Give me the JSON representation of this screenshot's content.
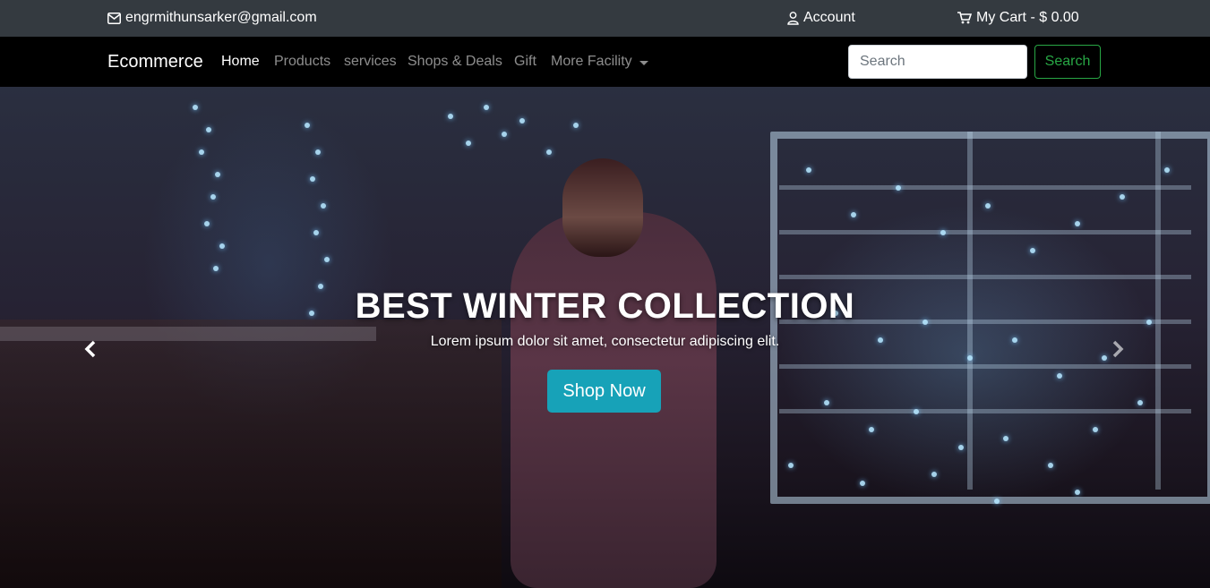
{
  "topbar": {
    "email": "engrmithunsarker@gmail.com",
    "account_label": "Account",
    "cart_label": "My Cart - $ 0.00",
    "icons": {
      "email": "envelope-icon",
      "account": "user-icon",
      "cart": "shopping-cart-icon"
    }
  },
  "navbar": {
    "brand": "Ecommerce",
    "links": [
      {
        "label": "Home",
        "active": true
      },
      {
        "label": "Products"
      },
      {
        "label": "services"
      },
      {
        "label": "Shops & Deals"
      },
      {
        "label": "Gift"
      },
      {
        "label": "More Facility"
      }
    ],
    "search_placeholder": "Search",
    "search_button": "Search"
  },
  "hero": {
    "title": "BEST WINTER COLLECTION",
    "subtitle": "Lorem ipsum dolor sit amet, consectetur adipiscing elit.",
    "cta_label": "Shop Now",
    "prev_icon": "chevron-left-icon",
    "next_icon": "chevron-right-icon"
  },
  "colors": {
    "topbar_bg": "#343a40",
    "navbar_bg": "#000000",
    "search_accent": "#28a745",
    "cta_bg": "#17a2b8"
  }
}
